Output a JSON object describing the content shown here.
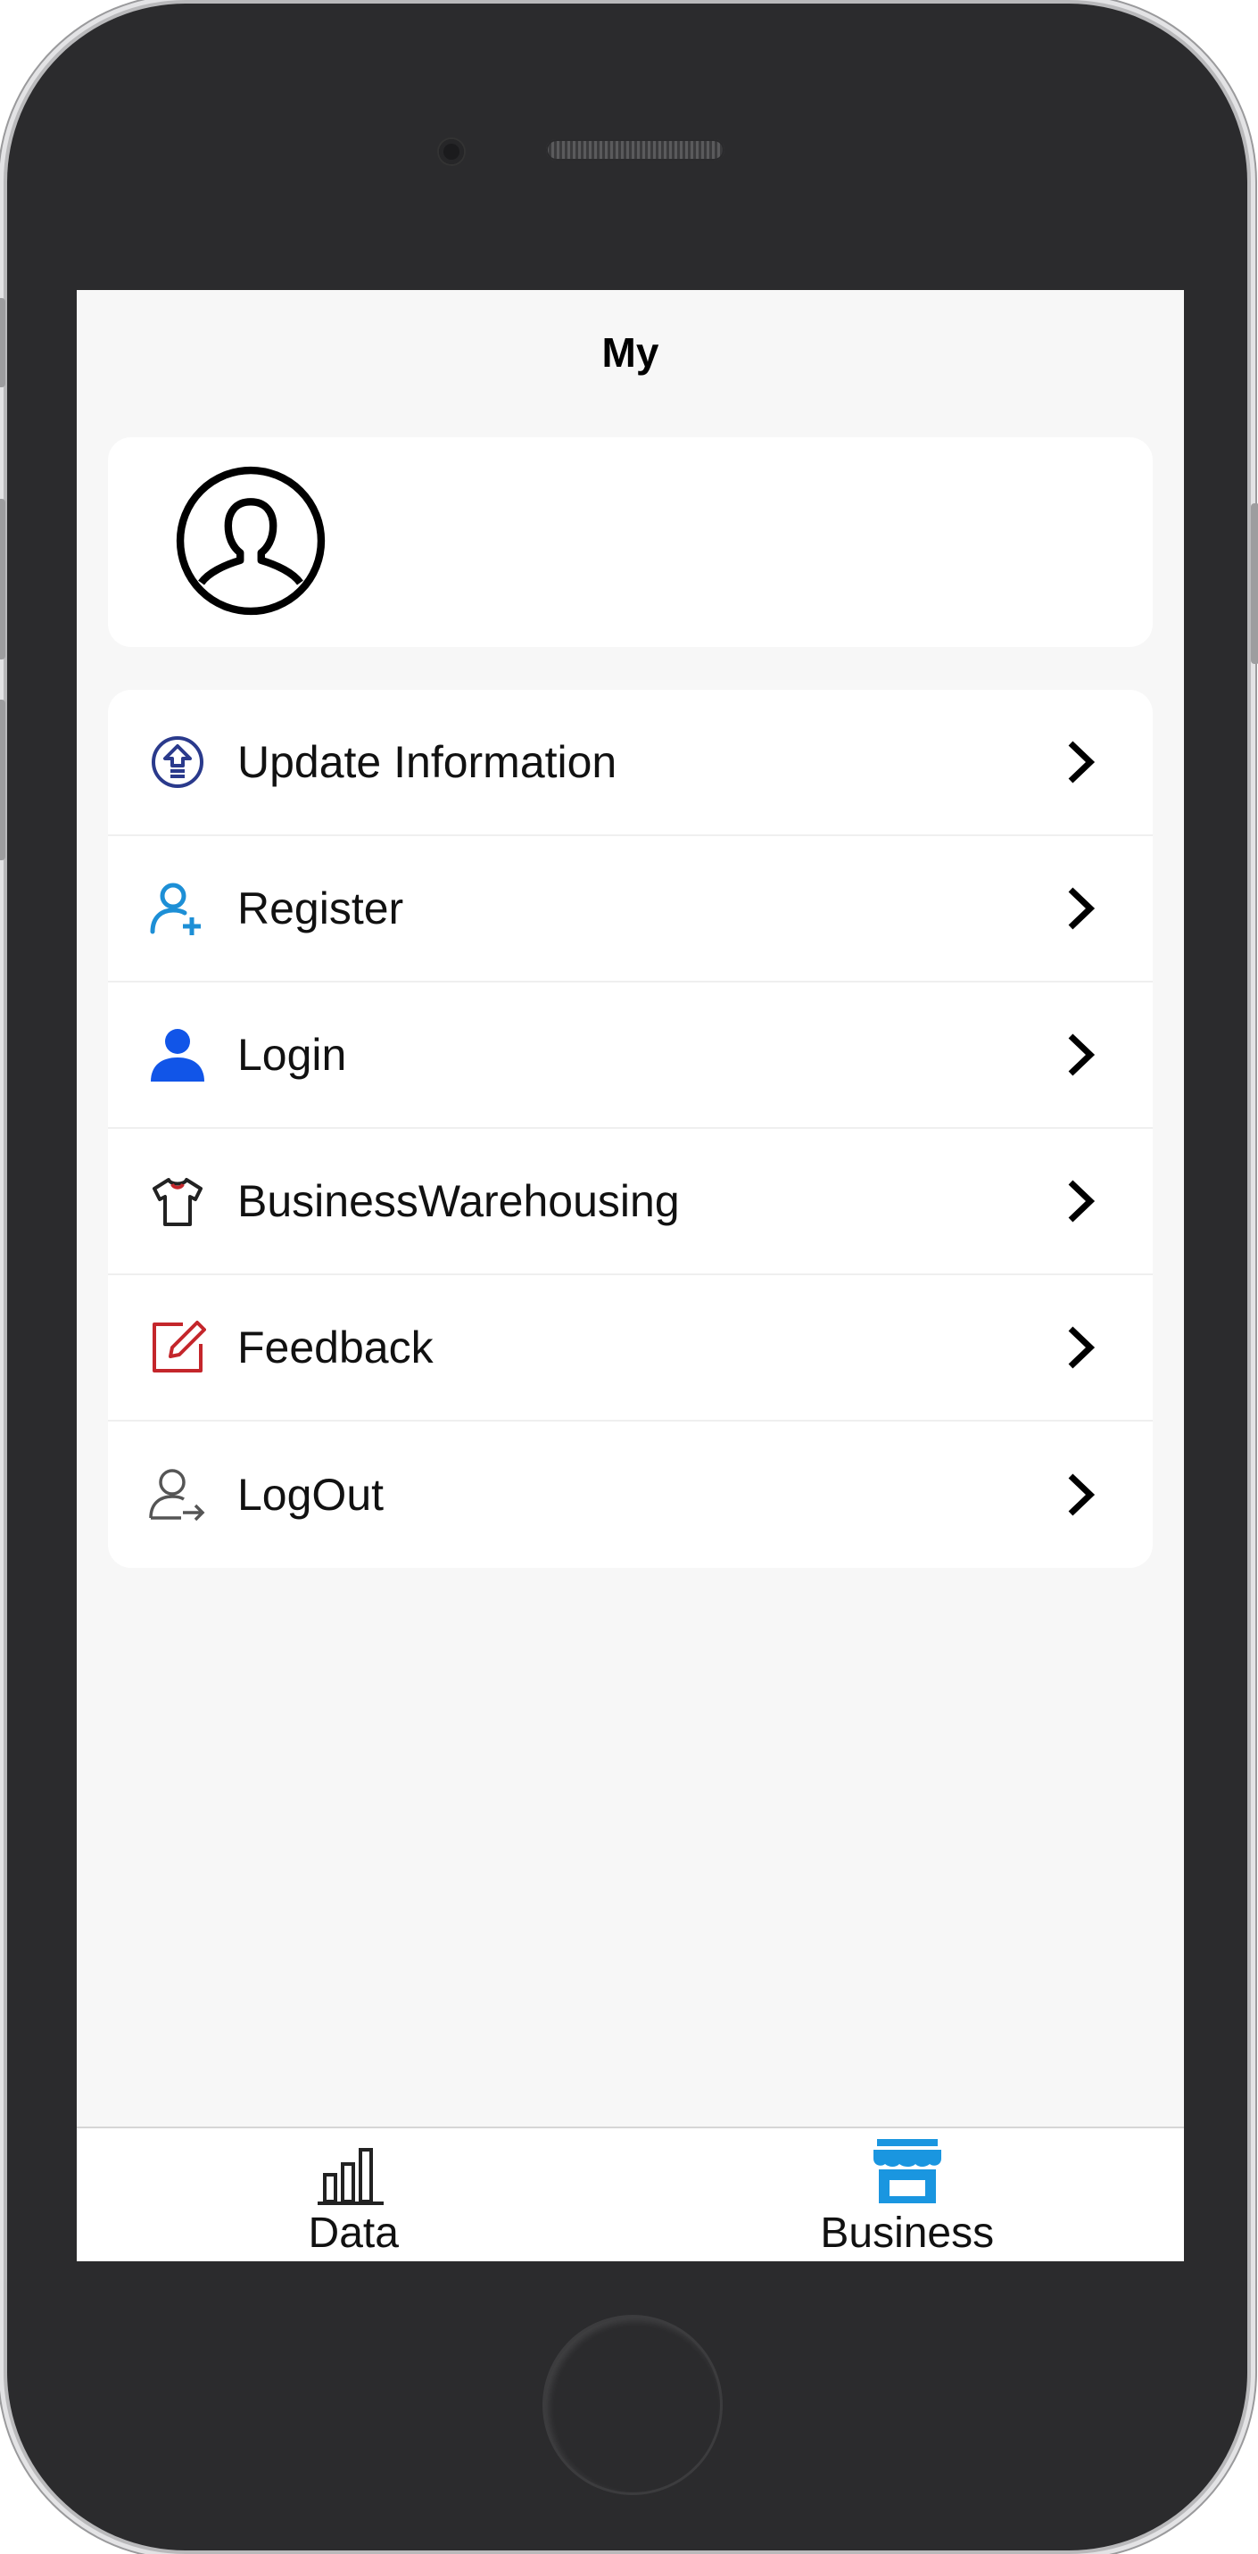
{
  "header": {
    "title": "My"
  },
  "profile": {
    "avatar_icon": "user-avatar-icon"
  },
  "menu": {
    "items": [
      {
        "label": "Update Information",
        "icon": "upload-circle-icon",
        "color": "#2a3a8c"
      },
      {
        "label": "Register",
        "icon": "user-add-icon",
        "color": "#1d8fd6"
      },
      {
        "label": "Login",
        "icon": "user-icon",
        "color": "#1155e8"
      },
      {
        "label": "BusinessWarehousing",
        "icon": "shirt-icon",
        "color": "#222222"
      },
      {
        "label": "Feedback",
        "icon": "edit-icon",
        "color": "#c4262b"
      },
      {
        "label": "LogOut",
        "icon": "logout-user-icon",
        "color": "#555555"
      }
    ]
  },
  "tabbar": {
    "tabs": [
      {
        "label": "Data",
        "icon": "bar-chart-icon",
        "active": false
      },
      {
        "label": "Business",
        "icon": "store-icon",
        "active": true,
        "color": "#1a96e0"
      }
    ]
  }
}
